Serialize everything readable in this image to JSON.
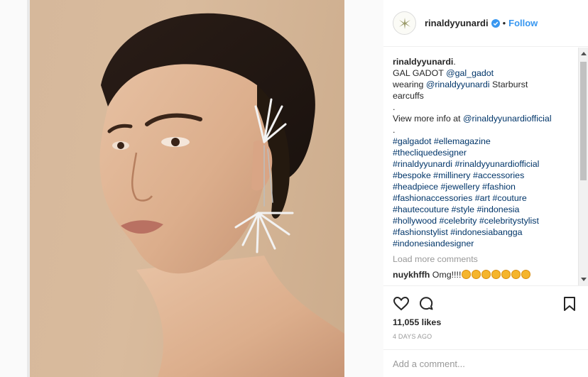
{
  "post": {
    "username": "rinaldyyunardi",
    "follow_label": "Follow",
    "separator": "•",
    "caption": {
      "username": "rinaldyyunardi",
      "title_suffix": ".",
      "line1_text": "GAL GADOT ",
      "line1_mention": "@gal_gadot",
      "line2_text": "wearing ",
      "line2_mention": "@rinaldyyunardi",
      "line2_after": " Starburst",
      "line3_text": "earcuffs",
      "line4_text": ".",
      "line5_text": "View more info at ",
      "line5_mention": "@rinaldyyunardiofficial",
      "line6_text": ".",
      "hashtag_lines": [
        "#galgadot #ellemagazine",
        "#thecliquedesigner",
        "#rinaldyyunardi #rinaldyyunardiofficial",
        "#bespoke #millinery #accessories",
        "#headpiece #jewellery #fashion",
        "#fashionaccessories #art #couture",
        "#hautecouture #style #indonesia",
        "#hollywood #celebrity #celebritystylist",
        "#fashionstylist #indonesiabangga",
        "#indonesiandesigner"
      ]
    },
    "load_more": "Load more comments",
    "comments": [
      {
        "user": "nuykhffh",
        "text": "Omg!!!!",
        "emoji_count": 7
      }
    ],
    "likes": "11,055 likes",
    "time": "4 DAYS AGO",
    "add_comment_placeholder": "Add a comment..."
  },
  "icons": {
    "like": "heart-icon",
    "comment": "speech-bubble-icon",
    "save": "bookmark-icon",
    "verified": "verified-badge-icon",
    "emoji": "clapping-hands-emoji"
  },
  "colors": {
    "link": "#3897f0",
    "hashtag": "#003569",
    "muted": "#999999",
    "text": "#262626"
  }
}
